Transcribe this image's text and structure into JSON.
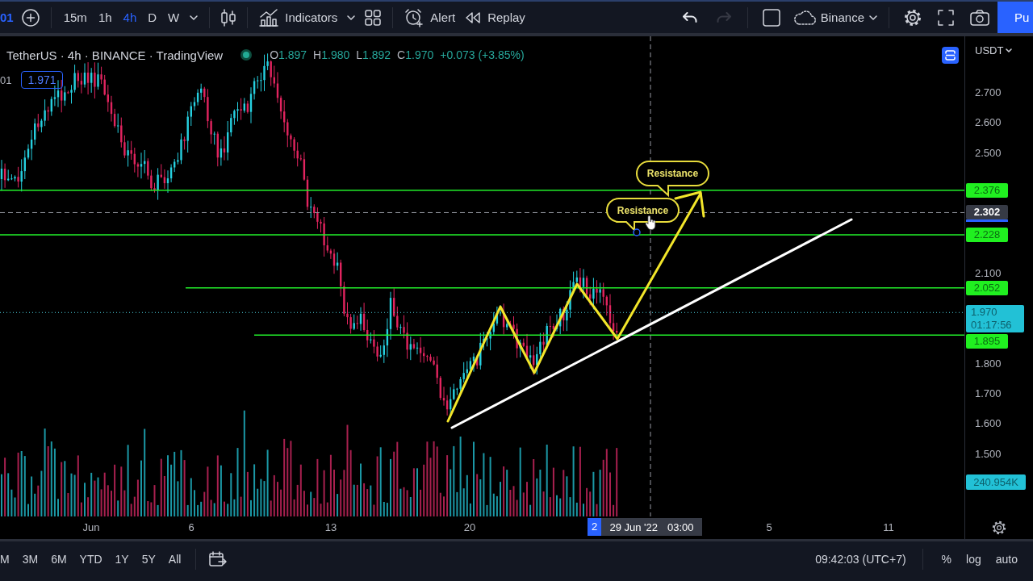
{
  "toolbar": {
    "symbol_partial": "01",
    "intervals": [
      {
        "label": "15m",
        "selected": false
      },
      {
        "label": "1h",
        "selected": false
      },
      {
        "label": "4h",
        "selected": true
      },
      {
        "label": "D",
        "selected": false
      },
      {
        "label": "W",
        "selected": false
      }
    ],
    "indicators": "Indicators",
    "alert": "Alert",
    "replay": "Replay",
    "history": [
      {
        "kind": "undo",
        "disabled": false
      },
      {
        "kind": "redo",
        "disabled": true
      }
    ],
    "broker": "Binance",
    "publish": "Pu"
  },
  "legend": {
    "title": "TetherUS · 4h · BINANCE · TradingView",
    "ohlc": [
      {
        "label": "O",
        "value": "1.897"
      },
      {
        "label": "H",
        "value": "1.980"
      },
      {
        "label": "L",
        "value": "1.892"
      },
      {
        "label": "C",
        "value": "1.970"
      }
    ],
    "change": "+0.073 (+3.85%)",
    "row_partial": "01",
    "price_tag": "1.971"
  },
  "chart": {
    "callouts": [
      {
        "text": "Resistance"
      },
      {
        "text": "Resistance"
      }
    ]
  },
  "price_axis": {
    "currency": "USDT",
    "ticks": [
      "2.700",
      "2.600",
      "2.500",
      "2.100",
      "1.800",
      "1.700",
      "1.600",
      "1.500"
    ],
    "labels": [
      {
        "kind": "level",
        "text": "2.376"
      },
      {
        "kind": "crosshair",
        "text": "2.302"
      },
      {
        "kind": "level",
        "text": "2.228"
      },
      {
        "kind": "level",
        "text": "2.052"
      },
      {
        "kind": "last",
        "text": "1.970",
        "countdown": "01:17:56"
      },
      {
        "kind": "level",
        "text": "1.895"
      },
      {
        "kind": "volume",
        "text": "240.954K"
      }
    ]
  },
  "time_axis": {
    "ticks": [
      "Jun",
      "6",
      "13",
      "20",
      "5",
      "11"
    ],
    "marker": "2",
    "crosshair_date": "29 Jun '22",
    "crosshair_time": "03:00"
  },
  "bottom_bar": {
    "ranges": [
      {
        "label": "M",
        "selected": false
      },
      {
        "label": "3M",
        "selected": false
      },
      {
        "label": "6M",
        "selected": false
      },
      {
        "label": "YTD",
        "selected": false
      },
      {
        "label": "1Y",
        "selected": false
      },
      {
        "label": "5Y",
        "selected": false
      },
      {
        "label": "All",
        "selected": false
      }
    ],
    "clock": "09:42:03 (UTC+7)",
    "scale_options": [
      {
        "label": "%",
        "selected": false
      },
      {
        "label": "log",
        "selected": false
      },
      {
        "label": "auto",
        "selected": false
      }
    ]
  }
}
